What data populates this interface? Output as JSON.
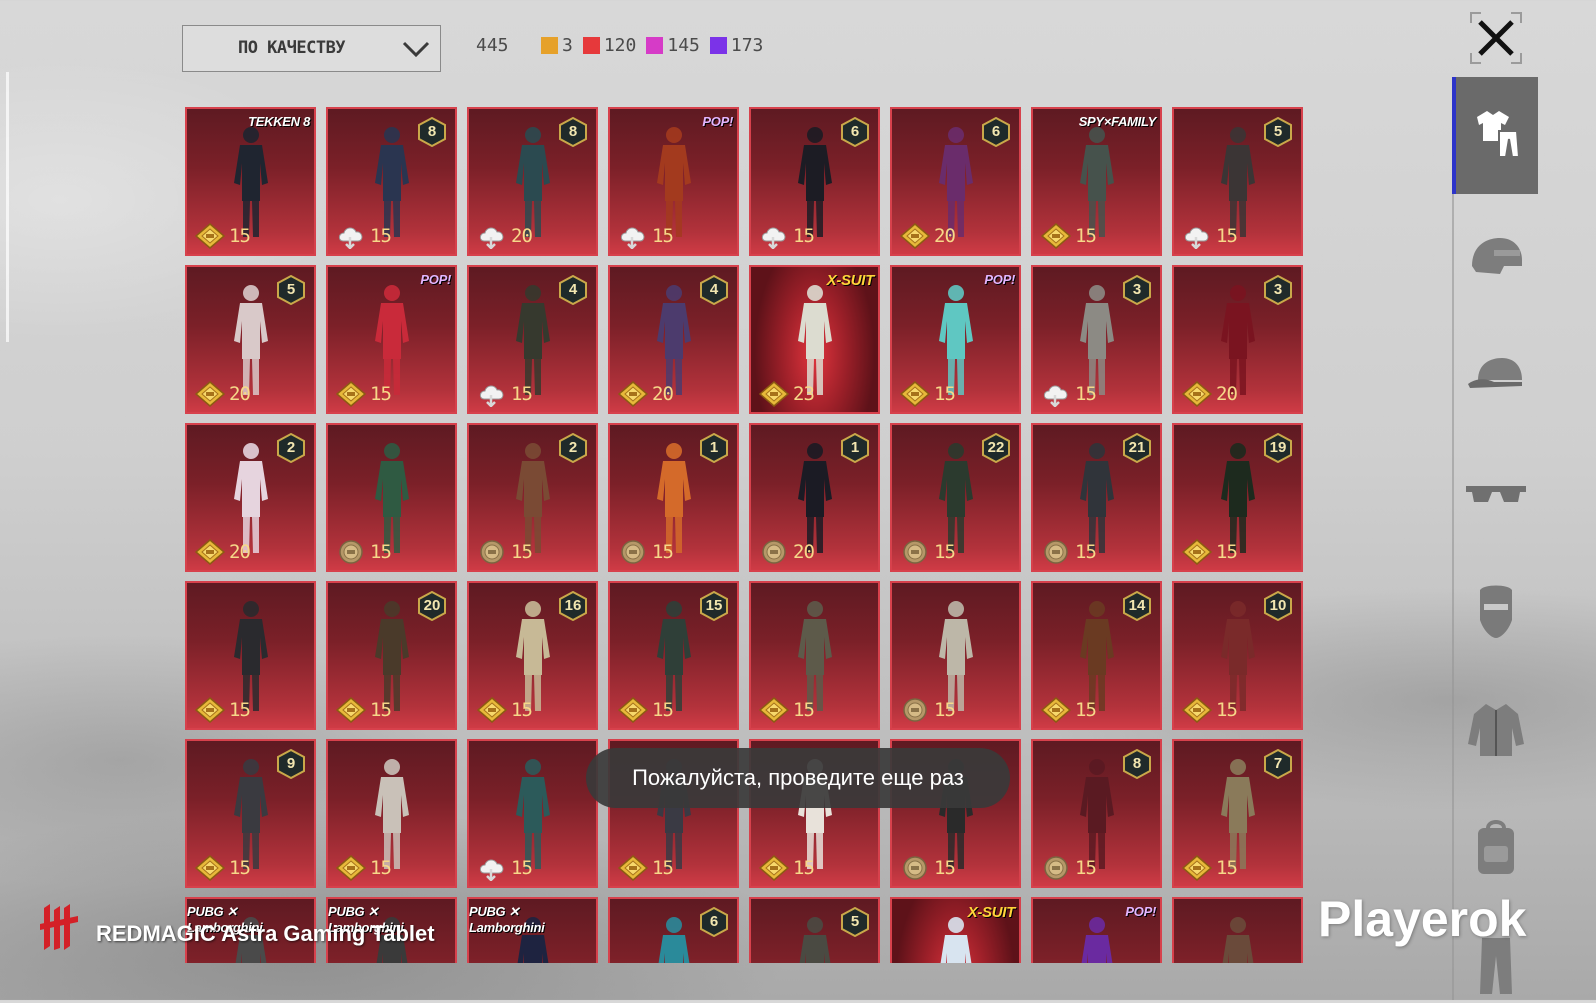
{
  "toolbar": {
    "sort_label": "ПО КАЧЕСТВУ",
    "total_count": "445",
    "rarity_counts": [
      {
        "value": "3",
        "color": "#e6a12a"
      },
      {
        "value": "120",
        "color": "#e6393b"
      },
      {
        "value": "145",
        "color": "#d63bc7"
      },
      {
        "value": "173",
        "color": "#7b33e8"
      }
    ]
  },
  "items": [
    {
      "cost": "15",
      "currency": "gold",
      "label": "TEKKEN 8",
      "label_style": "brand",
      "color": "#1f2530"
    },
    {
      "cost": "15",
      "currency": "cloud",
      "badge": "8",
      "color": "#2a3550"
    },
    {
      "cost": "20",
      "currency": "cloud",
      "badge": "8",
      "color": "#2b4a50"
    },
    {
      "cost": "15",
      "currency": "cloud",
      "label": "POP!",
      "label_style": "pop",
      "color": "#a33a1e"
    },
    {
      "cost": "15",
      "currency": "cloud",
      "badge": "6",
      "color": "#1c1c24"
    },
    {
      "cost": "20",
      "currency": "gold",
      "badge": "6",
      "color": "#6a2c6b"
    },
    {
      "cost": "15",
      "currency": "gold",
      "label": "SPY×FAMILY",
      "label_style": "brand",
      "color": "#46524c"
    },
    {
      "cost": "15",
      "currency": "cloud",
      "badge": "5",
      "color": "#3b3535"
    },
    {
      "cost": "20",
      "currency": "gold",
      "badge": "5",
      "color": "#d9c9c9"
    },
    {
      "cost": "15",
      "currency": "gold",
      "label": "POP!",
      "label_style": "pop",
      "color": "#c92a3a"
    },
    {
      "cost": "15",
      "currency": "cloud",
      "badge": "4",
      "color": "#36392e"
    },
    {
      "cost": "20",
      "currency": "gold",
      "badge": "4",
      "color": "#4c3b6d"
    },
    {
      "cost": "23",
      "currency": "gold",
      "label": "X-SUIT",
      "label_style": "xs",
      "color": "#dcdcd0",
      "xsuit": true
    },
    {
      "cost": "15",
      "currency": "gold",
      "label": "POP!",
      "label_style": "pop",
      "color": "#5fc7c2"
    },
    {
      "cost": "15",
      "currency": "cloud",
      "badge": "3",
      "color": "#8c8a84"
    },
    {
      "cost": "20",
      "currency": "gold",
      "badge": "3",
      "color": "#7a1420"
    },
    {
      "cost": "20",
      "currency": "gold",
      "badge": "2",
      "color": "#e6d4de"
    },
    {
      "cost": "15",
      "currency": "silver",
      "color": "#2f5a42"
    },
    {
      "cost": "15",
      "currency": "silver",
      "badge": "2",
      "color": "#7a4a34"
    },
    {
      "cost": "15",
      "currency": "silver",
      "badge": "1",
      "color": "#d46a2a"
    },
    {
      "cost": "20",
      "currency": "silver",
      "badge": "1",
      "color": "#1b1b24"
    },
    {
      "cost": "15",
      "currency": "silver",
      "badge": "22",
      "color": "#2b3a2e"
    },
    {
      "cost": "15",
      "currency": "silver",
      "badge": "21",
      "color": "#30343a"
    },
    {
      "cost": "15",
      "currency": "gold",
      "badge": "19",
      "color": "#1d2a1e"
    },
    {
      "cost": "15",
      "currency": "gold",
      "color": "#2a2a2e"
    },
    {
      "cost": "15",
      "currency": "gold",
      "badge": "20",
      "color": "#4a3a2a"
    },
    {
      "cost": "15",
      "currency": "gold",
      "badge": "16",
      "color": "#c7b996"
    },
    {
      "cost": "15",
      "currency": "gold",
      "badge": "15",
      "color": "#2f3f38"
    },
    {
      "cost": "15",
      "currency": "gold",
      "color": "#5d5a4a"
    },
    {
      "cost": "15",
      "currency": "silver",
      "color": "#bdb7a8"
    },
    {
      "cost": "15",
      "currency": "gold",
      "badge": "14",
      "color": "#6a3a22"
    },
    {
      "cost": "15",
      "currency": "gold",
      "badge": "10",
      "color": "#7a2a2a"
    },
    {
      "cost": "15",
      "currency": "gold",
      "badge": "9",
      "color": "#3a3a40"
    },
    {
      "cost": "15",
      "currency": "gold",
      "color": "#c9c1b8"
    },
    {
      "cost": "15",
      "currency": "cloud",
      "color": "#2c5a5a"
    },
    {
      "cost": "15",
      "currency": "gold",
      "color": "#3a3a44"
    },
    {
      "cost": "15",
      "currency": "gold",
      "color": "#e8e2da"
    },
    {
      "cost": "15",
      "currency": "silver",
      "color": "#2a2a2a"
    },
    {
      "cost": "15",
      "currency": "silver",
      "badge": "8",
      "color": "#5a1a22"
    },
    {
      "cost": "15",
      "currency": "gold",
      "badge": "7",
      "color": "#8a7a5a"
    },
    {
      "label": "PUBG ✕ Lamborghini",
      "label_style": "brand",
      "color": "#4a4a4a"
    },
    {
      "label": "PUBG ✕ Lamborghini",
      "label_style": "brand",
      "color": "#3a3a3a"
    },
    {
      "label": "PUBG ✕ Lamborghini",
      "label_style": "brand",
      "color": "#1e2340"
    },
    {
      "badge": "6",
      "color": "#2a8a9a"
    },
    {
      "badge": "5",
      "color": "#4a4a42"
    },
    {
      "label": "X-SUIT",
      "label_style": "xs",
      "color": "#d8e4f0",
      "xsuit": true
    },
    {
      "label": "POP!",
      "label_style": "pop",
      "color": "#6a2aa0"
    },
    {
      "color": "#6a4a3a"
    }
  ],
  "toast": "Пожалуйста, проведите еще раз",
  "sidebar": [
    {
      "name": "outfit-icon",
      "active": true
    },
    {
      "name": "helmet-icon"
    },
    {
      "name": "cap-icon"
    },
    {
      "name": "glasses-icon"
    },
    {
      "name": "mask-icon"
    },
    {
      "name": "jacket-icon"
    },
    {
      "name": "backpack-icon"
    },
    {
      "name": "pants-icon"
    }
  ],
  "watermark_left": "REDMAGIC Astra Gaming Tablet",
  "watermark_right": "Playerok"
}
